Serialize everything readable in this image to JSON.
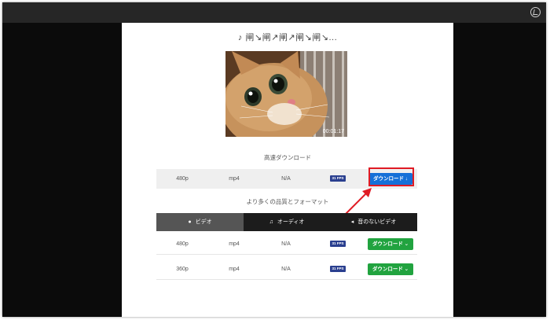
{
  "page": {
    "title": "♪ 闸↘闸↗闸↗闸↘闸↘..."
  },
  "video": {
    "duration": "00:01:17"
  },
  "fast_download": {
    "label": "高速ダウンロード",
    "row": {
      "quality": "480p",
      "format": "mp4",
      "size": "N/A",
      "fps": "31 FPS",
      "button": "ダウンロード ↓"
    }
  },
  "more_formats": {
    "label": "より多くの品質とフォーマット"
  },
  "tabs": [
    {
      "label": "ビデオ",
      "icon": "play-circle-icon",
      "active": true
    },
    {
      "label": "オーディオ",
      "icon": "music-note-icon",
      "active": false
    },
    {
      "label": "音のないビデオ",
      "icon": "speaker-muted-icon",
      "active": false
    }
  ],
  "rows": [
    {
      "quality": "480p",
      "format": "mp4",
      "size": "N/A",
      "fps": "31 FPS",
      "button": "ダウンロード ⌄"
    },
    {
      "quality": "360p",
      "format": "mp4",
      "size": "N/A",
      "fps": "31 FPS",
      "button": "ダウンロード ⌄"
    }
  ],
  "colors": {
    "blue_button": "#1570d8",
    "green_button": "#21a33f",
    "highlight": "#e01b24",
    "active_tab": "#555555"
  }
}
